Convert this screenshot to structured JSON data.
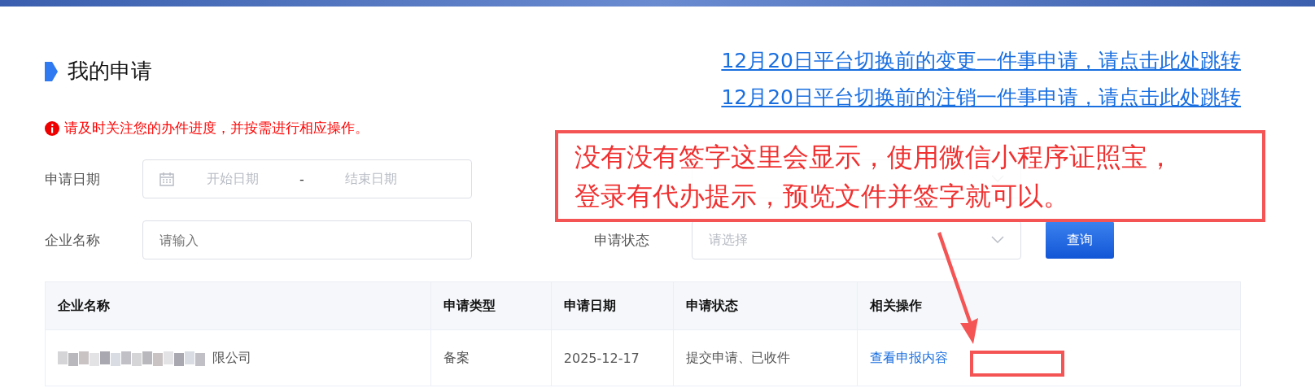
{
  "title": "我的申请",
  "links": [
    "12月20日平台切换前的变更一件事申请，请点击此处跳转",
    "12月20日平台切换前的注销一件事申请，请点击此处跳转"
  ],
  "notice": "请及时关注您的办件进度，并按需进行相应操作。",
  "filters": [
    {
      "kind": "daterange",
      "label": "申请日期",
      "start_placeholder": "开始日期",
      "separator": "-",
      "end_placeholder": "结束日期"
    },
    {
      "kind": "select"
    },
    {
      "kind": "input",
      "label": "企业名称",
      "placeholder": "请输入"
    },
    {
      "kind": "select",
      "label": "申请状态",
      "placeholder": "请选择"
    }
  ],
  "query_button": "查询",
  "table": {
    "columns": [
      "企业名称",
      "申请类型",
      "申请日期",
      "申请状态",
      "相关操作"
    ],
    "rows": [
      {
        "company": "限公司",
        "company_redacted": true,
        "type": "备案",
        "date": "2025-12-17",
        "status": "提交申请、已收件",
        "action": "查看申报内容"
      }
    ]
  },
  "annotation": {
    "lines": [
      "没有没有签字这里会显示，使用微信小程序证照宝，",
      "登录有代办提示，预览文件并签字就可以。"
    ]
  }
}
